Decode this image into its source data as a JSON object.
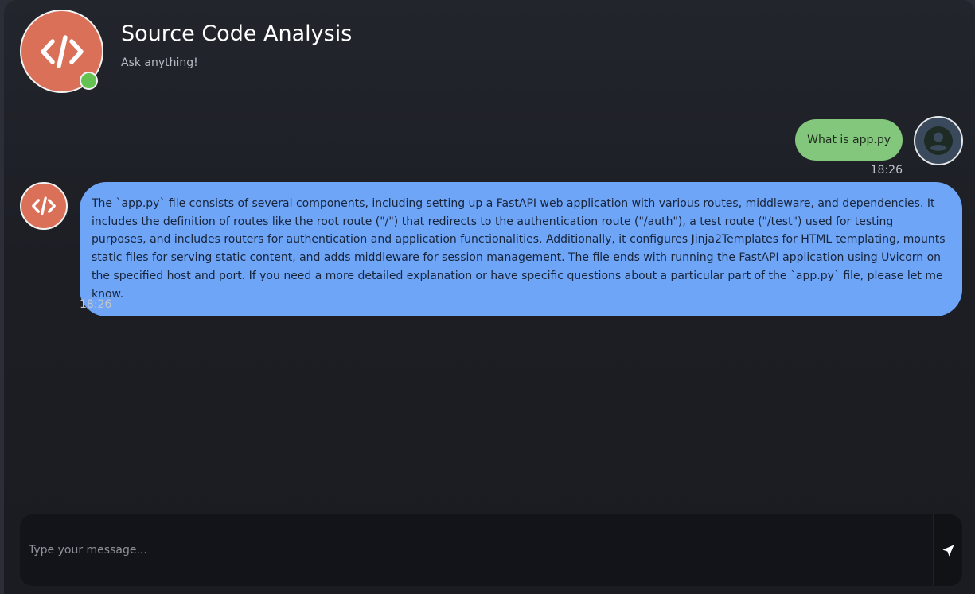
{
  "header": {
    "title": "Source Code Analysis",
    "subtitle": "Ask anything!",
    "avatar_icon": "code-icon",
    "status": "online",
    "accent_color": "#d97057",
    "status_color": "#63c252"
  },
  "messages": [
    {
      "sender": "user",
      "text": "What is app.py",
      "time": "18:26",
      "bubble_color": "#83c77d",
      "avatar_icon": "user-icon"
    },
    {
      "sender": "bot",
      "text": "The `app.py` file consists of several components, including setting up a FastAPI web application with various routes, middleware, and dependencies. It includes the definition of routes like the root route (\"/\") that redirects to the authentication route (\"/auth\"), a test route (\"/test\") used for testing purposes, and includes routers for authentication and application functionalities. Additionally, it configures Jinja2Templates for HTML templating, mounts static files for serving static content, and adds middleware for session management. The file ends with running the FastAPI application using Uvicorn on the specified host and port. If you need a more detailed explanation or have specific questions about a particular part of the `app.py` file, please let me know.",
      "time": "18:26",
      "bubble_color": "#6fa5f7",
      "avatar_icon": "code-icon"
    }
  ],
  "composer": {
    "placeholder": "Type your message...",
    "value": "",
    "send_icon": "send-icon"
  }
}
